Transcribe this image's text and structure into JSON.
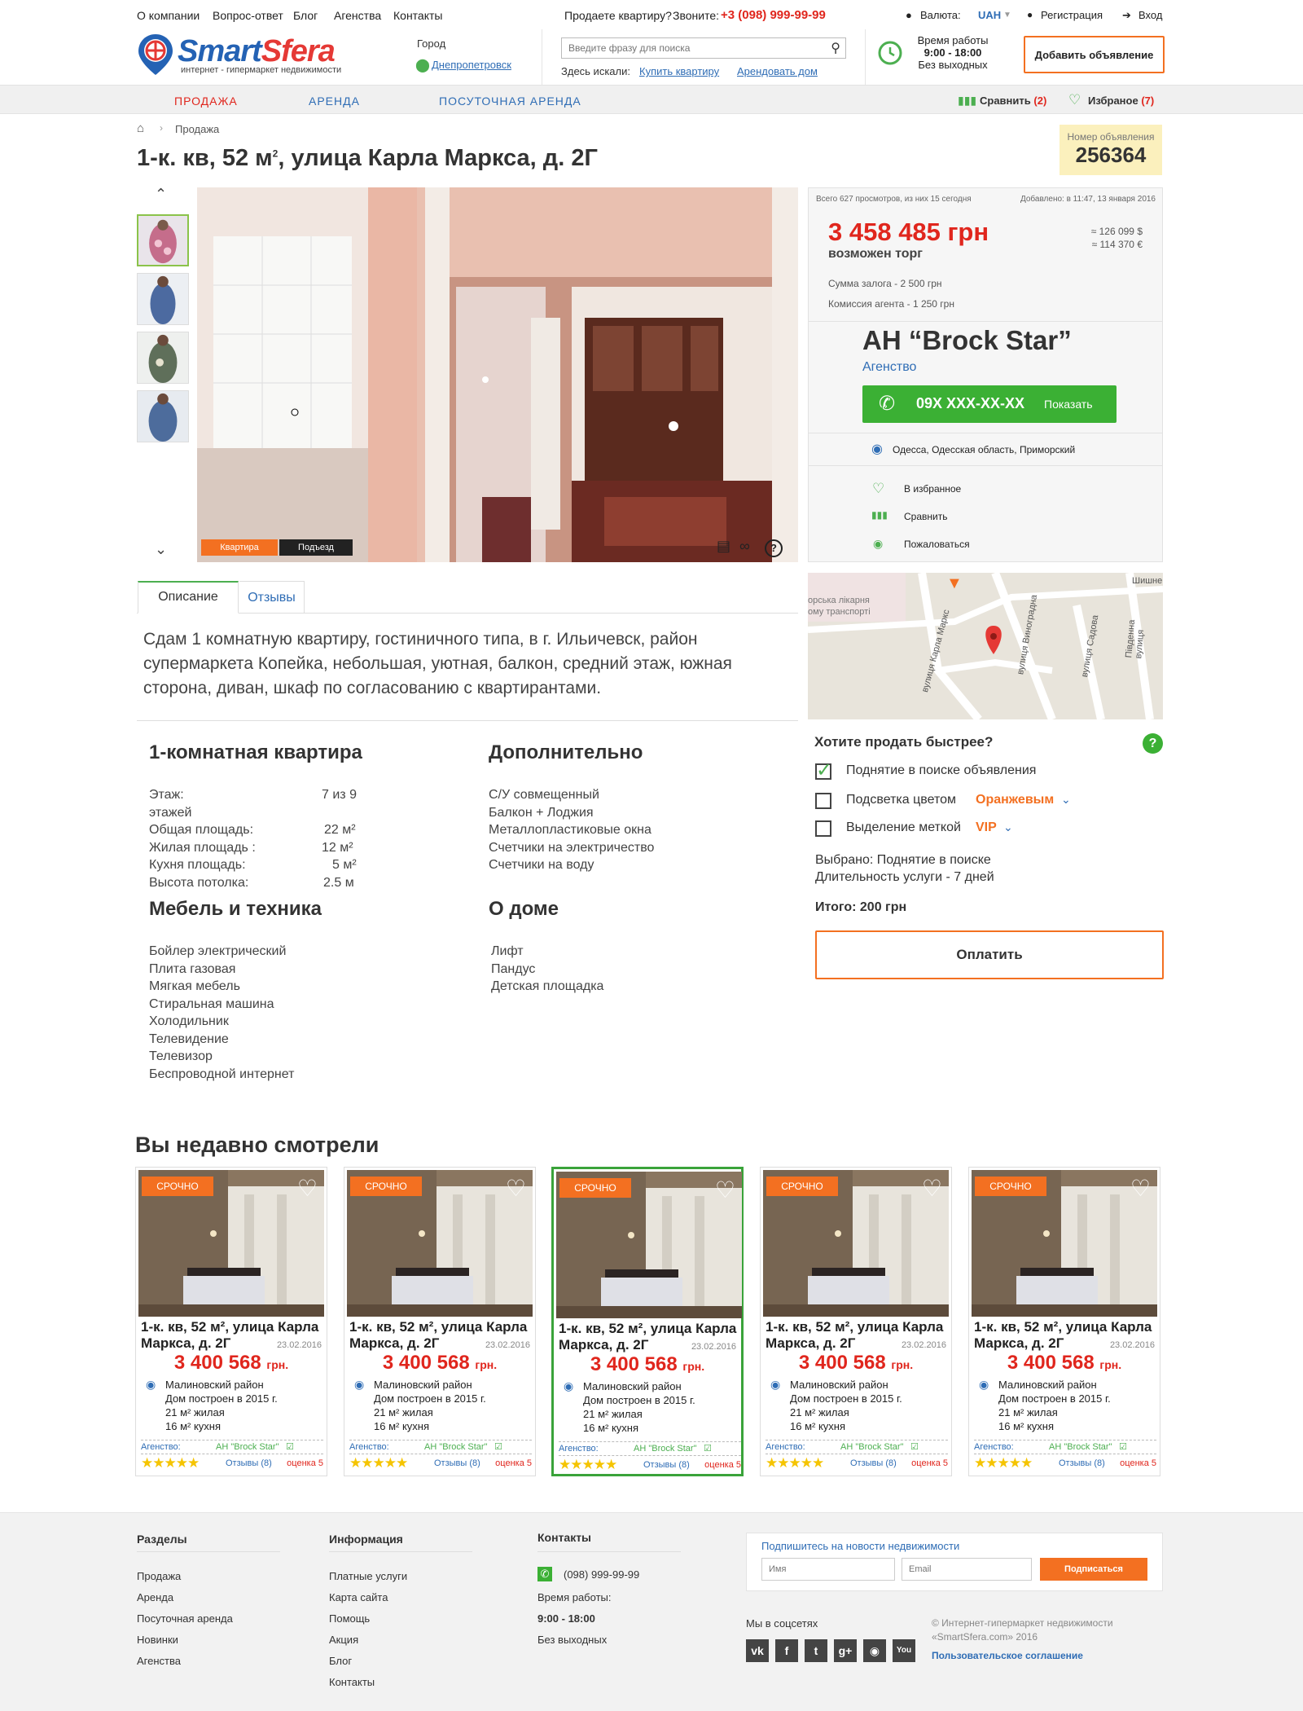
{
  "topbar": {
    "links": [
      "О компании",
      "Вопрос-ответ",
      "Блог",
      "Агенства",
      "Контакты"
    ],
    "sell_question": "Продаете квартиру?",
    "call_label": "Звоните:",
    "phone": "+3 (098) 999-99-99",
    "currency_label": "Валюта:",
    "currency": "UAH",
    "register": "Регистрация",
    "login": "Вход"
  },
  "header": {
    "logo_smart": "Smart",
    "logo_sfera": "Sfera",
    "logo_tagline": "интернет - гипермаркет недвижимости",
    "city_label": "Город",
    "city": "Днепропетровск",
    "search_placeholder": "Введите фразу для поиска",
    "searched_label": "Здесь искали:",
    "searched_1": "Купить квартиру",
    "searched_2": "Арендовать дом",
    "hours_title": "Время работы",
    "hours": "9:00 - 18:00",
    "hours_days": "Без выходных",
    "add_button": "Добавить объявление"
  },
  "nav": {
    "sale": "ПРОДАЖА",
    "rent": "АРЕНДА",
    "daily": "ПОСУТОЧНАЯ АРЕНДА",
    "compare": "Сравнить",
    "compare_count": "(2)",
    "favorites": "Избраное",
    "favorites_count": "(7)"
  },
  "breadcrumb": {
    "item": "Продажа"
  },
  "listing": {
    "title_main": "1-к. кв, 52 м",
    "title_sup": "2",
    "title_rest": ", улица Карла Маркса, д. 2Г",
    "number_label": "Номер объявления",
    "number": "256364"
  },
  "gallery": {
    "tag_flat": "Квартира",
    "tag_entrance": "Подъезд"
  },
  "price_panel": {
    "views": "Всего 627 просмотров, из них 15 сегодня",
    "added": "Добавлено: в 11:47, 13 января 2016",
    "price": "3 458 485 грн",
    "bargain": "возможен торг",
    "usd": "≈ 126 099  $",
    "eur": "≈ 114 370  €",
    "deposit": "Сумма залога - 2 500 грн",
    "commission": "Комиссия агента - 1 250 грн"
  },
  "agency": {
    "name": "АН “Brock Star”",
    "type": "Агенство",
    "phone": "09X XXX-XX-XX",
    "show": "Показать",
    "address": "Одесса, Одесская область, Приморский",
    "to_favorites": "В избранное",
    "compare": "Сравнить",
    "complain": "Пожаловаться"
  },
  "map": {
    "street_1": "вулиця Карла Маркс",
    "street_2": "вулиця Виноградна",
    "street_3": "вулиця Садова",
    "street_4": "Південна вулиця",
    "poi": "орська лікарня",
    "poi_2": "ому транспорті",
    "street_5": "Шишнев"
  },
  "tabs": {
    "description": "Описание",
    "reviews": "Отзывы"
  },
  "description": "Сдам 1 комнатную квартиру, гостиничного типа, в г. Ильичевск, район супермаркета Копейка, небольшая, уютная, балкон, средний этаж, южная сторона, диван, шкаф по согласованию с квартирантами.",
  "specs": {
    "title": "1-комнатная квартира",
    "rows": [
      {
        "label": "Этаж:",
        "value": "7 из 9 этажей"
      },
      {
        "label": "Общая площадь:",
        "value": "22 м²"
      },
      {
        "label": "Жилая площадь :",
        "value": "12 м²"
      },
      {
        "label": "Кухня площадь:",
        "value": "5 м²"
      },
      {
        "label": "Высота потолка:",
        "value": "2.5 м"
      }
    ]
  },
  "extra": {
    "title": "Дополнительно",
    "items": [
      "С/У совмещенный",
      "Балкон + Лоджия",
      "Металлопластиковые окна",
      "Счетчики на электричество",
      "Счетчики на воду"
    ]
  },
  "furniture": {
    "title": "Мебель и техника",
    "items": [
      "Бойлер электрический",
      "Плита газовая",
      "Мягкая мебель",
      "Стиральная машина",
      "Холодильник",
      "Телевидение",
      "Телевизор",
      "Беспроводной интернет"
    ]
  },
  "house": {
    "title": "О доме",
    "items": [
      "Лифт",
      "Пандус",
      "Детская площадка"
    ]
  },
  "promo": {
    "title": "Хотите продать быстрее?",
    "opt1": "Поднятие в поиске объявления",
    "opt2": "Подсветка цветом",
    "opt2_value": "Оранжевым",
    "opt3": "Выделение меткой",
    "opt3_value": "VIP",
    "selected": "Выбрано: Поднятие в поиске",
    "duration": "Длительность услуги - 7 дней",
    "total": "Итого: 200 грн",
    "pay": "Оплатить"
  },
  "recent": {
    "title": "Вы недавно смотрели",
    "cards": [
      {
        "badge": "СРОЧНО",
        "title": "1-к. кв, 52 м², улица Карла Маркса, д. 2Г",
        "date": "23.02.2016",
        "price": "3 400 568",
        "currency": "грн.",
        "district": "Малиновский район",
        "built": "Дом построен в 2015 г.",
        "living": "21 м² жилая",
        "kitchen": "16 м² кухня",
        "agency_label": "Агенство:",
        "agency": "АН \"Brock Star\"",
        "reviews": "Отзывы (8)",
        "rating": "оценка 5"
      },
      {
        "badge": "СРОЧНО",
        "title": "1-к. кв, 52 м², улица Карла Маркса, д. 2Г",
        "date": "23.02.2016",
        "price": "3 400 568",
        "currency": "грн.",
        "district": "Малиновский район",
        "built": "Дом построен в 2015 г.",
        "living": "21 м² жилая",
        "kitchen": "16 м² кухня",
        "agency_label": "Агенство:",
        "agency": "АН \"Brock Star\"",
        "reviews": "Отзывы (8)",
        "rating": "оценка 5"
      },
      {
        "badge": "СРОЧНО",
        "title": "1-к. кв, 52 м², улица Карла Маркса, д. 2Г",
        "date": "23.02.2016",
        "price": "3 400 568",
        "currency": "грн.",
        "district": "Малиновский район",
        "built": "Дом построен в 2015 г.",
        "living": "21 м² жилая",
        "kitchen": "16 м² кухня",
        "agency_label": "Агенство:",
        "agency": "АН \"Brock Star\"",
        "reviews": "Отзывы (8)",
        "rating": "оценка 5"
      },
      {
        "badge": "СРОЧНО",
        "title": "1-к. кв, 52 м², улица Карла Маркса, д. 2Г",
        "date": "23.02.2016",
        "price": "3 400 568",
        "currency": "грн.",
        "district": "Малиновский район",
        "built": "Дом построен в 2015 г.",
        "living": "21 м² жилая",
        "kitchen": "16 м² кухня",
        "agency_label": "Агенство:",
        "agency": "АН \"Brock Star\"",
        "reviews": "Отзывы (8)",
        "rating": "оценка 5"
      },
      {
        "badge": "СРОЧНО",
        "title": "1-к. кв, 52 м², улица Карла Маркса, д. 2Г",
        "date": "23.02.2016",
        "price": "3 400 568",
        "currency": "грн.",
        "district": "Малиновский район",
        "built": "Дом построен в 2015 г.",
        "living": "21 м² жилая",
        "kitchen": "16 м² кухня",
        "agency_label": "Агенство:",
        "agency": "АН \"Brock Star\"",
        "reviews": "Отзывы (8)",
        "rating": "оценка 5"
      }
    ]
  },
  "footer": {
    "sections_title": "Разделы",
    "sections": [
      "Продажа",
      "Аренда",
      "Посуточная аренда",
      "Новинки",
      "Агенства"
    ],
    "info_title": "Информация",
    "info": [
      "Платные услуги",
      "Карта сайта",
      "Помощь",
      "Акция",
      "Блог",
      "Контакты"
    ],
    "contacts_title": "Контакты",
    "phone": "(098) 999-99-99",
    "hours_title": "Время работы:",
    "hours": "9:00 - 18:00",
    "days": "Без выходных",
    "subscribe_title": "Подпишитесь на новости недвижимости",
    "name_placeholder": "Имя",
    "email_placeholder": "Email",
    "subscribe_button": "Подписаться",
    "social_title": "Мы в соцсетях",
    "copyright_1": "© Интернет-гипермаркет недвижимости",
    "copyright_2": "«SmartSfera.com» 2016",
    "agreement": "Пользовательское соглашение"
  }
}
